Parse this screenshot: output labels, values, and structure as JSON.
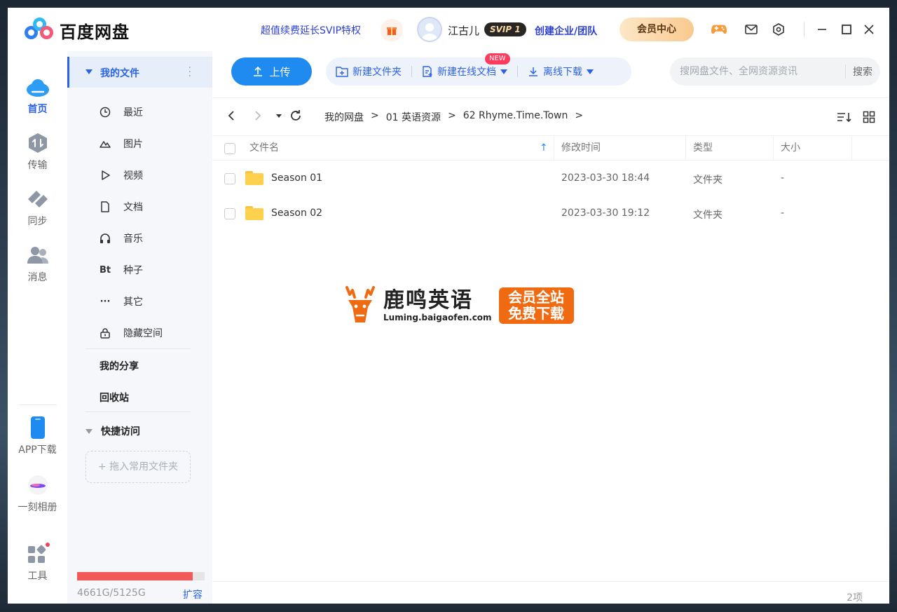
{
  "app": {
    "title": "百度网盘"
  },
  "header": {
    "promo": "超值续费延长SVIP特权",
    "username": "江古儿",
    "badge": "SVIP 1",
    "enterprise": "创建企业/团队",
    "vip_center": "会员中心"
  },
  "rail": [
    {
      "label": "首页",
      "icon": "cloud-icon"
    },
    {
      "label": "传输",
      "icon": "transfer-icon"
    },
    {
      "label": "同步",
      "icon": "sync-icon"
    },
    {
      "label": "消息",
      "icon": "message-icon"
    },
    {
      "label": "APP下载",
      "icon": "phone-icon"
    },
    {
      "label": "一刻相册",
      "icon": "album-icon"
    },
    {
      "label": "工具",
      "icon": "tools-icon"
    }
  ],
  "sidebar": {
    "my_files": "我的文件",
    "items": [
      {
        "label": "最近",
        "icon": "clock-icon"
      },
      {
        "label": "图片",
        "icon": "image-icon"
      },
      {
        "label": "视频",
        "icon": "play-icon"
      },
      {
        "label": "文档",
        "icon": "document-icon"
      },
      {
        "label": "音乐",
        "icon": "headphones-icon"
      },
      {
        "label": "种子",
        "icon": "bt-icon",
        "glyph": "Bt"
      },
      {
        "label": "其它",
        "icon": "more-icon",
        "glyph": "···"
      },
      {
        "label": "隐藏空间",
        "icon": "lock-icon"
      }
    ],
    "my_share": "我的分享",
    "recycle": "回收站",
    "quick_access": "快捷访问",
    "drop_hint": "+ 拖入常用文件夹",
    "quota_text": "4661G/5125G",
    "quota_used_fraction": 0.909,
    "expand": "扩容"
  },
  "toolbar": {
    "upload": "上传",
    "new_folder": "新建文件夹",
    "new_doc": "新建在线文档",
    "new_badge": "NEW",
    "offline": "离线下载",
    "search_placeholder": "搜网盘文件、全网资源资讯",
    "search_button": "搜索"
  },
  "breadcrumb": [
    "我的网盘",
    ">",
    "01 英语资源",
    ">",
    "62 Rhyme.Time.Town",
    ">"
  ],
  "table": {
    "columns": {
      "name": "文件名",
      "modified": "修改时间",
      "type": "类型",
      "size": "大小"
    },
    "rows": [
      {
        "name": "Season 01",
        "modified": "2023-03-30 18:44",
        "type": "文件夹",
        "size": "-"
      },
      {
        "name": "Season 02",
        "modified": "2023-03-30 19:12",
        "type": "文件夹",
        "size": "-"
      }
    ]
  },
  "footer": {
    "count": "2项"
  },
  "watermark": {
    "title": "鹿鸣英语",
    "url": "Luming.baigaofen.com",
    "badge_line1": "会员全站",
    "badge_line2": "免费下载"
  },
  "colors": {
    "accent": "#2c62e8",
    "upload": "#1f8bf0",
    "quota": "#f25a5a",
    "watermark": "#f06a12"
  }
}
